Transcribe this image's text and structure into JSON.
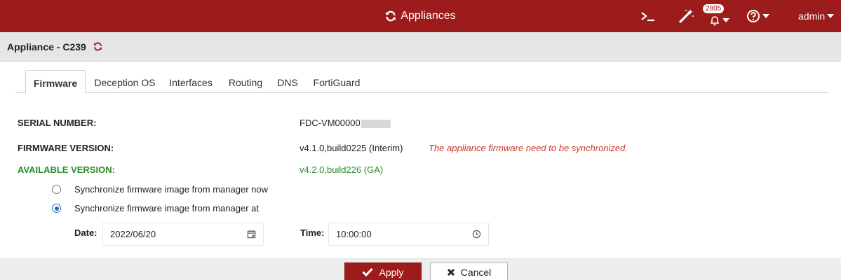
{
  "topbar": {
    "title": "Appliances",
    "notification_count": "2805",
    "user": "admin",
    "icons": [
      "console-icon",
      "magic-wand-icon",
      "bell-icon",
      "help-icon"
    ]
  },
  "subheader": {
    "title": "Appliance - C239"
  },
  "tabs": [
    {
      "label": "Firmware",
      "active": true
    },
    {
      "label": "Deception OS",
      "active": false
    },
    {
      "label": "Interfaces",
      "active": false
    },
    {
      "label": "Routing",
      "active": false
    },
    {
      "label": "DNS",
      "active": false
    },
    {
      "label": "FortiGuard",
      "active": false
    }
  ],
  "firmware": {
    "serial_label": "SERIAL NUMBER:",
    "serial_value": "FDC-VM00000",
    "version_label": "FIRMWARE VERSION:",
    "version_value": "v4.1.0,build0225 (Interim)",
    "version_warning": "The appliance firmware need to be synchronized.",
    "available_label": "AVAILABLE VERSION:",
    "available_value": "v4.2.0,build226 (GA)",
    "sync_options": [
      {
        "label": "Synchronize firmware image from manager now",
        "checked": false
      },
      {
        "label": "Synchronize firmware image from manager at",
        "checked": true
      }
    ],
    "date_label": "Date:",
    "date_value": "2022/06/20",
    "time_label": "Time:",
    "time_value": "10:00:00"
  },
  "footer": {
    "apply_label": "Apply",
    "cancel_label": "Cancel"
  },
  "colors": {
    "brand": "#9c1b1b",
    "available": "#2a8a2a",
    "warning": "#c0392b",
    "radio_selected": "#2b6cb0"
  }
}
